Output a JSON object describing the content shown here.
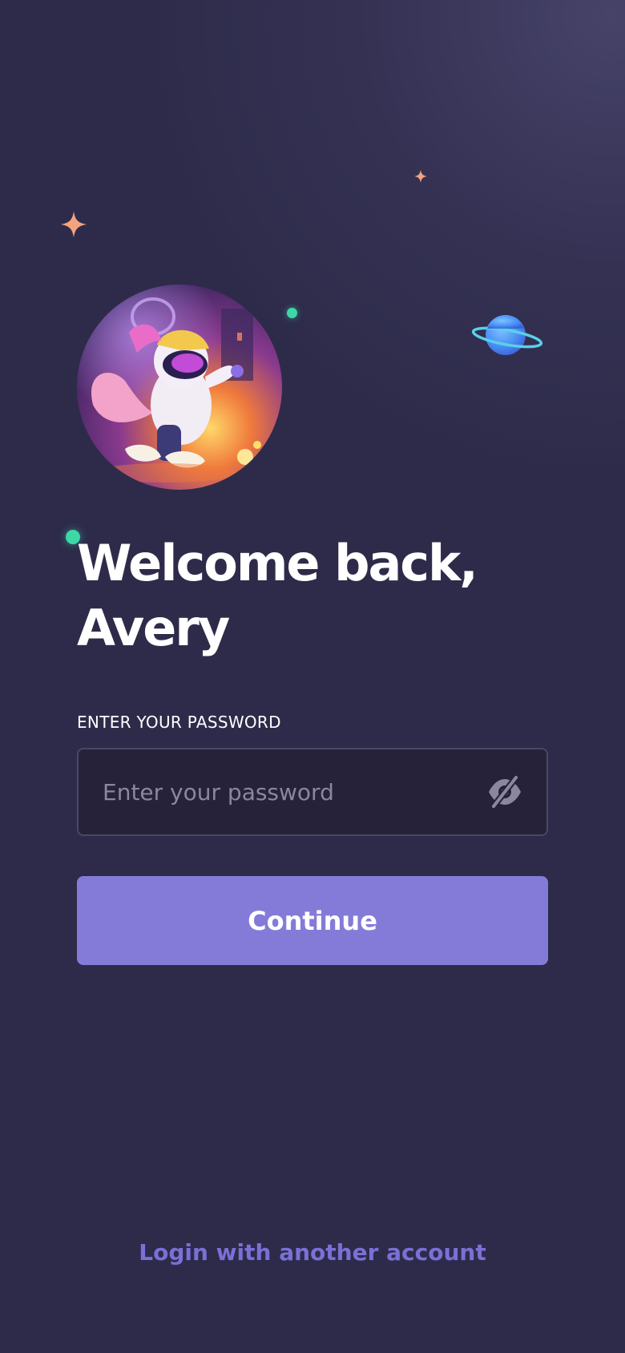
{
  "greeting": {
    "line1": "Welcome back,",
    "line2": "Avery"
  },
  "password": {
    "label": "ENTER YOUR PASSWORD",
    "placeholder": "Enter your password",
    "value": "",
    "toggle_icon": "eye-slash-icon"
  },
  "actions": {
    "continue_label": "Continue",
    "alt_login_label": "Login with another account"
  },
  "decorations": {
    "icons": [
      "sparkle-icon",
      "planet-icon",
      "dot"
    ],
    "avatar": "character-avatar"
  },
  "colors": {
    "background": "#2e2b4a",
    "input_background": "#25223a",
    "primary_button": "#847bd9",
    "link": "#7a70d6",
    "accent_green": "#3ed7a6",
    "accent_star": "#f4a37e",
    "planet_blue": "#4a90f5"
  }
}
